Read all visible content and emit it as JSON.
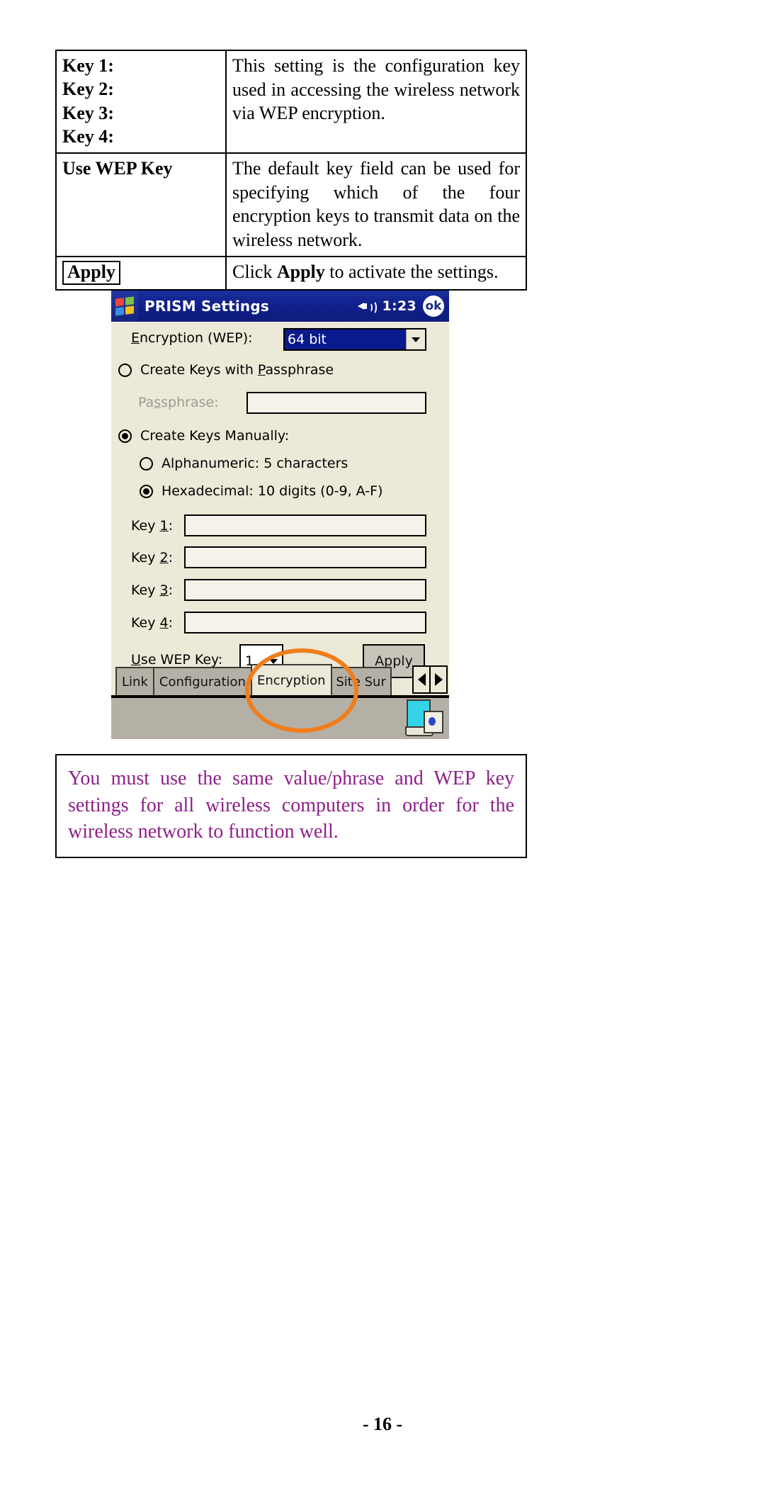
{
  "spec_table": {
    "rows": [
      {
        "term_lines": [
          "Key 1:",
          "Key 2:",
          "Key 3:",
          "Key 4:"
        ],
        "description": "This setting is the configuration key used in accessing the wireless network via WEP encryption."
      },
      {
        "term": "Use WEP Key",
        "description": "The default key field can be used for specifying which of the four encryption keys to transmit data on the wireless network."
      },
      {
        "term": "Apply",
        "description_pre": "Click ",
        "description_bold": "Apply",
        "description_post": " to activate the settings."
      }
    ]
  },
  "pda": {
    "titlebar": {
      "start_icon": "windows-flag-icon",
      "title": "PRISM Settings",
      "volume_icon": "speaker-icon",
      "time": "1:23",
      "ok_label": "ok"
    },
    "encryption": {
      "label_prefix": "E",
      "label_rest": "ncryption (WEP):",
      "selected_value": "64 bit",
      "dropdown_icon": "chevron-down-icon"
    },
    "passphrase_option": {
      "label_pre": "Create Keys with ",
      "label_key": "P",
      "label_post": "assphrase",
      "selected": false
    },
    "passphrase_field": {
      "label_pre": "Pa",
      "label_key": "s",
      "label_post": "sphrase:",
      "value": "",
      "enabled": false
    },
    "manual_option": {
      "label": "Create Keys Manually:",
      "selected": true
    },
    "alphanumeric_option": {
      "label": "Alphanumeric: 5 characters",
      "selected": false
    },
    "hexadecimal_option": {
      "label": "Hexadecimal: 10 digits (0-9, A-F)",
      "selected": true
    },
    "keys": [
      {
        "label_pre": "Key ",
        "label_key": "1",
        "label_post": ":",
        "value": ""
      },
      {
        "label_pre": "Key ",
        "label_key": "2",
        "label_post": ":",
        "value": ""
      },
      {
        "label_pre": "Key ",
        "label_key": "3",
        "label_post": ":",
        "value": ""
      },
      {
        "label_pre": "Key ",
        "label_key": "4",
        "label_post": ":",
        "value": ""
      }
    ],
    "use_wep_key": {
      "label_key": "U",
      "label_rest": "se WEP Key:",
      "selected_value": "1",
      "dropdown_icon": "chevron-down-icon"
    },
    "apply_button": {
      "label": "Apply"
    },
    "tabs": [
      {
        "label": "Link",
        "active": false
      },
      {
        "label": "Configuration",
        "active": false
      },
      {
        "label": "Encryption",
        "active": true
      },
      {
        "label": "Site Sur",
        "active": false
      }
    ],
    "tab_scroll": {
      "prev_icon": "triangle-left-icon",
      "next_icon": "triangle-right-icon"
    },
    "taskbar": {
      "sip_icon": "input-panel-icon"
    },
    "annotation": {
      "shape": "ellipse",
      "color": "#f07d1a",
      "targets": "Encryption tab"
    }
  },
  "note": {
    "text": "You must use the same value/phrase and WEP key settings for all wireless computers in order for the wireless network to function well.",
    "color": "#8e2089"
  },
  "footer": {
    "page_number": "- 16 -"
  }
}
